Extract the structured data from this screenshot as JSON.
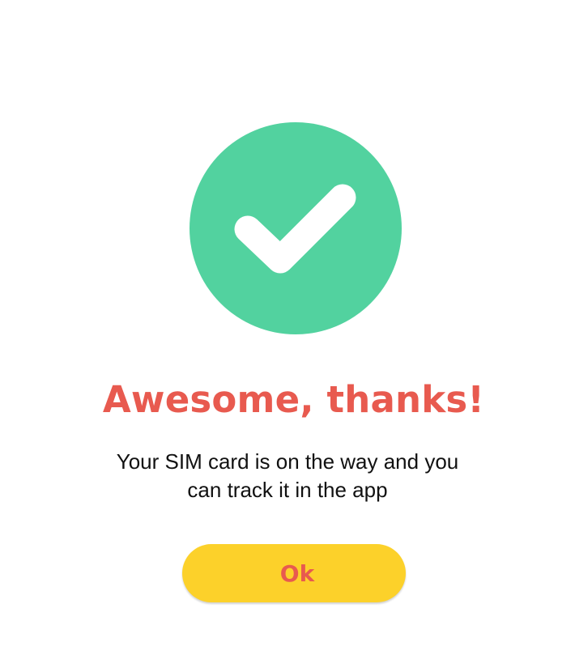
{
  "success_icon": {
    "icon": "check-circle-icon",
    "circle_color": "#52d29f",
    "check_color": "#ffffff"
  },
  "dialog": {
    "title": "Awesome, thanks!",
    "message_line_1": "Your SIM card is on the way and you",
    "message_line_2": "can track it in the app",
    "ok_label": "Ok"
  },
  "colors": {
    "background": "#ffffff",
    "title": "#e85a4f",
    "message": "#111111",
    "button_background": "#fcd12a",
    "button_text": "#e85a4f"
  }
}
